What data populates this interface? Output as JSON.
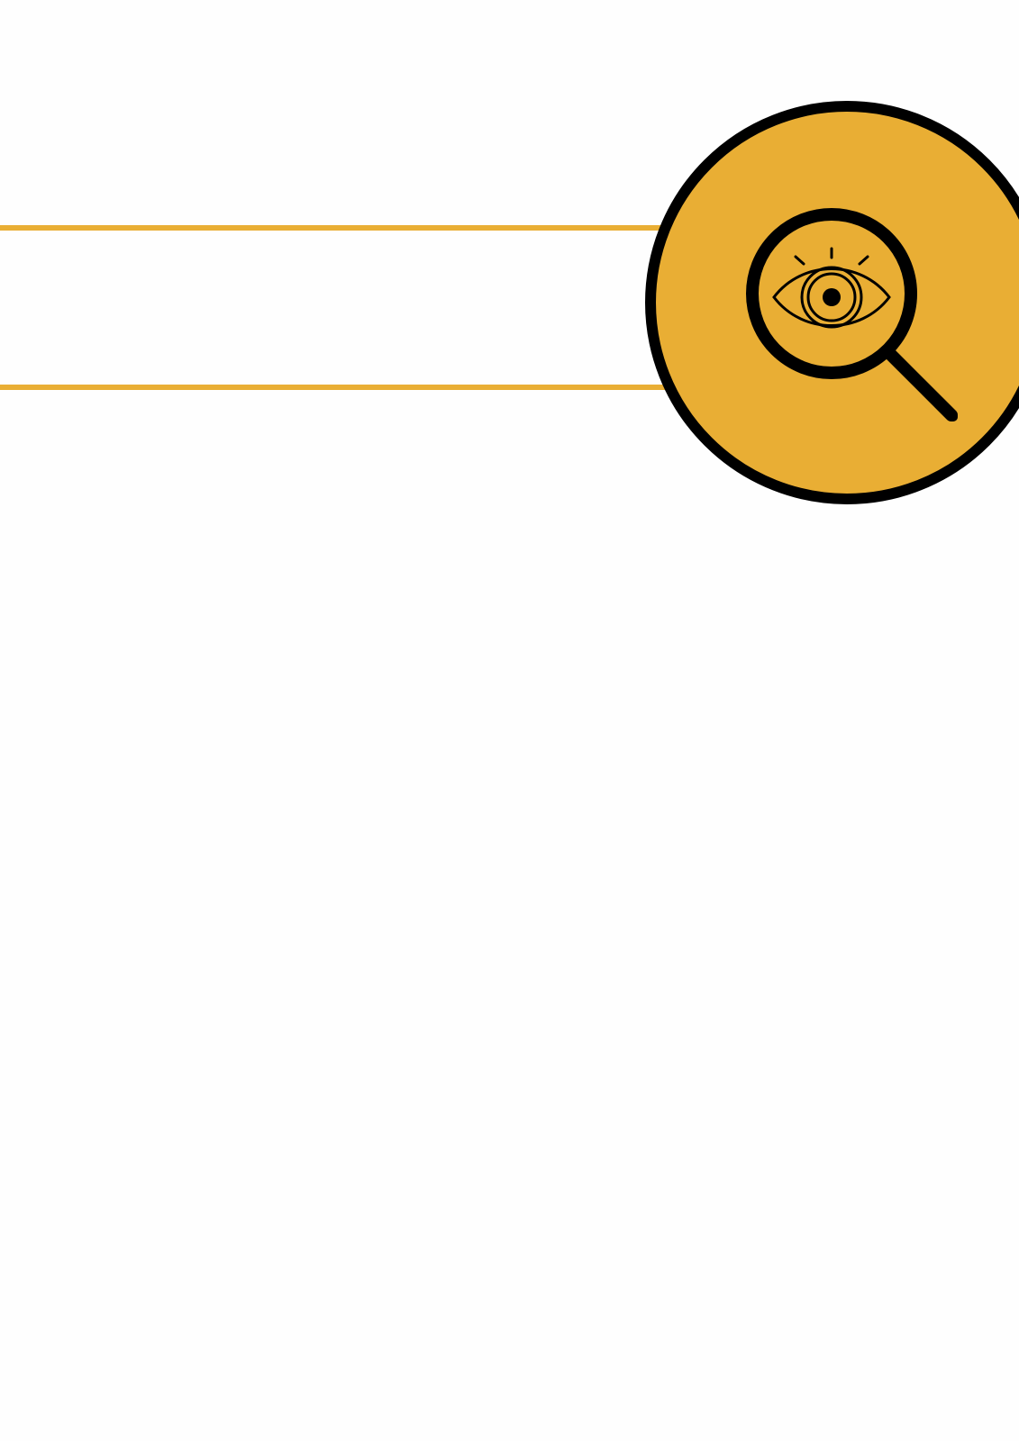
{
  "document": {
    "title": ""
  },
  "badge": {
    "icon": "eye-magnifier-icon",
    "fill_color": "#e9ae34",
    "outline_color": "#000000"
  },
  "accent_color": "#e9ae34",
  "background_color": "#fefefe"
}
